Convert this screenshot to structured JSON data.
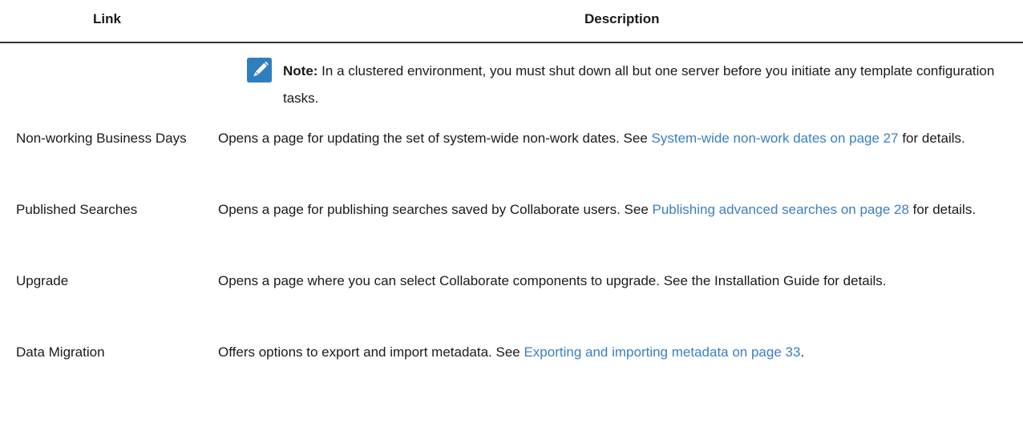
{
  "table": {
    "headers": {
      "link": "Link",
      "description": "Description"
    },
    "note": {
      "icon": "pencil-icon",
      "label": "Note:",
      "text": " In a clustered environment, you must shut down all but one server before you initiate any template configuration tasks."
    },
    "rows": [
      {
        "link": "Non-working Business Days",
        "desc_before": "Opens a page for updating the set of system-wide non-work dates. See ",
        "xref": "System-wide non-work dates on page 27",
        "desc_after": " for details."
      },
      {
        "link": "Published Searches",
        "desc_before": "Opens a page for publishing searches saved by Collaborate users. See ",
        "xref": "Publishing advanced searches on page 28",
        "desc_after": " for details."
      },
      {
        "link": "Upgrade",
        "desc_before": "Opens a page where you can select Collaborate components to upgrade. See the Installation Guide for details.",
        "xref": "",
        "desc_after": ""
      },
      {
        "link": "Data Migration",
        "desc_before": "Offers options to export and import metadata. See ",
        "xref": "Exporting and importing metadata on page 33",
        "desc_after": "."
      }
    ]
  },
  "colors": {
    "link": "#3a7fc1",
    "icon_bg": "#2e7fc0",
    "rule": "#333333"
  }
}
